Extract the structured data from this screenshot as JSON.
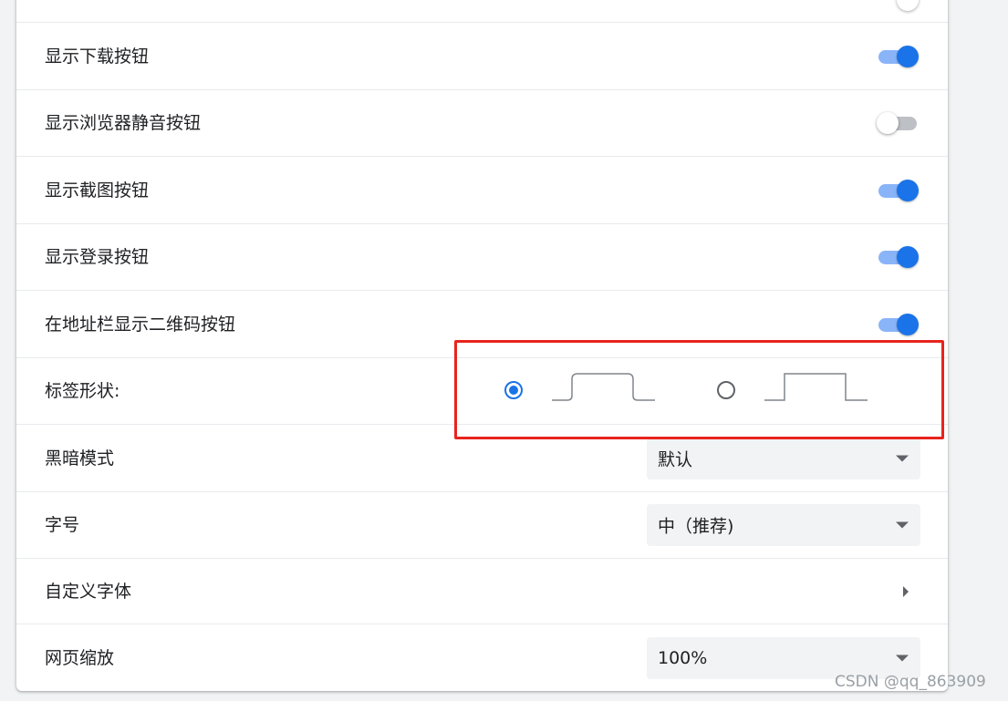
{
  "settings": {
    "rows": [
      {
        "label": "显示下载按钮",
        "on": true
      },
      {
        "label": "显示浏览器静音按钮",
        "on": false
      },
      {
        "label": "显示截图按钮",
        "on": true
      },
      {
        "label": "显示登录按钮",
        "on": true
      },
      {
        "label": "在地址栏显示二维码按钮",
        "on": true
      }
    ],
    "tab_shape": {
      "label": "标签形状:",
      "options": [
        {
          "name": "rounded",
          "selected": true
        },
        {
          "name": "square",
          "selected": false
        }
      ]
    },
    "dark_mode": {
      "label": "黑暗模式",
      "value": "默认"
    },
    "font_size": {
      "label": "字号",
      "value": "中（推荐)"
    },
    "custom_font": {
      "label": "自定义字体"
    },
    "page_zoom": {
      "label": "网页缩放",
      "value": "100%"
    }
  },
  "watermark": "CSDN @qq_863909",
  "colors": {
    "accent": "#1a73e8",
    "toggle_track_on": "#8ab4f8",
    "highlight": "#e8241d"
  }
}
